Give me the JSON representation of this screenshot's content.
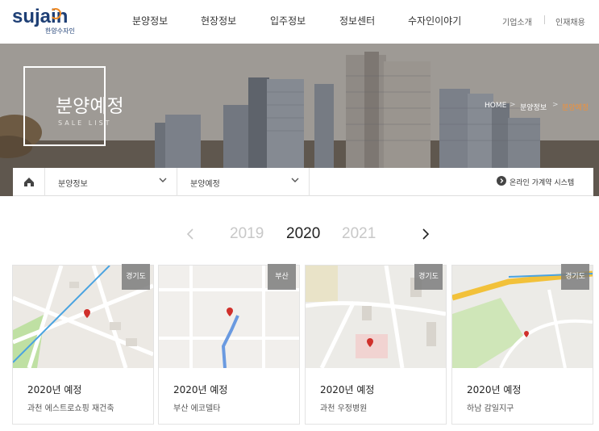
{
  "header": {
    "logo": {
      "main": "sujain",
      "sub": "한양수자인"
    },
    "gnb": [
      "분양정보",
      "현장정보",
      "입주정보",
      "정보센터",
      "수자인이야기"
    ],
    "util": [
      "기업소개",
      "인재채용"
    ]
  },
  "hero": {
    "title": "분양예정",
    "subtitle": "SALE LIST",
    "breadcrumb": [
      "HOME",
      "분양정보",
      "분양예정"
    ]
  },
  "subnav": {
    "home_icon": "home-icon",
    "dropdown1": "분양정보",
    "dropdown2": "분양예정",
    "online": "온라인 가계약 시스템"
  },
  "years": {
    "prev": "2019",
    "current": "2020",
    "next": "2021"
  },
  "cards": [
    {
      "region": "경기도",
      "title": "2020년 예정",
      "name": "과천 에스트로쇼핑 재건축"
    },
    {
      "region": "부산",
      "title": "2020년 예정",
      "name": "부산 에코델타"
    },
    {
      "region": "경기도",
      "title": "2020년 예정",
      "name": "과천 우정병원"
    },
    {
      "region": "경기도",
      "title": "2020년 예정",
      "name": "하남 감일지구"
    }
  ],
  "colors": {
    "brand": "#1e3f75",
    "accent": "#f0913a",
    "badge": "#7d7d7d"
  }
}
